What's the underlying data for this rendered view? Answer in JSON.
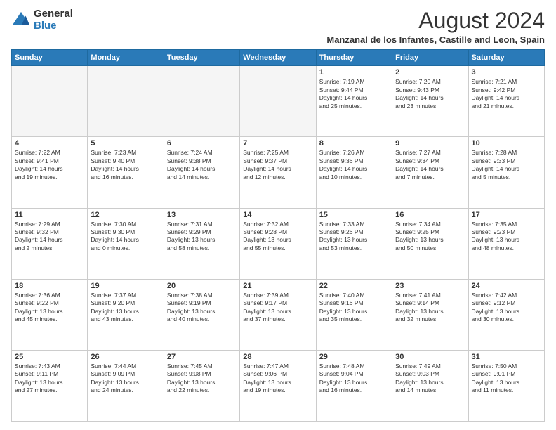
{
  "header": {
    "logo_general": "General",
    "logo_blue": "Blue",
    "title": "August 2024",
    "subtitle": "Manzanal de los Infantes, Castille and Leon, Spain"
  },
  "columns": [
    "Sunday",
    "Monday",
    "Tuesday",
    "Wednesday",
    "Thursday",
    "Friday",
    "Saturday"
  ],
  "weeks": [
    [
      {
        "day": "",
        "info": ""
      },
      {
        "day": "",
        "info": ""
      },
      {
        "day": "",
        "info": ""
      },
      {
        "day": "",
        "info": ""
      },
      {
        "day": "1",
        "info": "Sunrise: 7:19 AM\nSunset: 9:44 PM\nDaylight: 14 hours\nand 25 minutes."
      },
      {
        "day": "2",
        "info": "Sunrise: 7:20 AM\nSunset: 9:43 PM\nDaylight: 14 hours\nand 23 minutes."
      },
      {
        "day": "3",
        "info": "Sunrise: 7:21 AM\nSunset: 9:42 PM\nDaylight: 14 hours\nand 21 minutes."
      }
    ],
    [
      {
        "day": "4",
        "info": "Sunrise: 7:22 AM\nSunset: 9:41 PM\nDaylight: 14 hours\nand 19 minutes."
      },
      {
        "day": "5",
        "info": "Sunrise: 7:23 AM\nSunset: 9:40 PM\nDaylight: 14 hours\nand 16 minutes."
      },
      {
        "day": "6",
        "info": "Sunrise: 7:24 AM\nSunset: 9:38 PM\nDaylight: 14 hours\nand 14 minutes."
      },
      {
        "day": "7",
        "info": "Sunrise: 7:25 AM\nSunset: 9:37 PM\nDaylight: 14 hours\nand 12 minutes."
      },
      {
        "day": "8",
        "info": "Sunrise: 7:26 AM\nSunset: 9:36 PM\nDaylight: 14 hours\nand 10 minutes."
      },
      {
        "day": "9",
        "info": "Sunrise: 7:27 AM\nSunset: 9:34 PM\nDaylight: 14 hours\nand 7 minutes."
      },
      {
        "day": "10",
        "info": "Sunrise: 7:28 AM\nSunset: 9:33 PM\nDaylight: 14 hours\nand 5 minutes."
      }
    ],
    [
      {
        "day": "11",
        "info": "Sunrise: 7:29 AM\nSunset: 9:32 PM\nDaylight: 14 hours\nand 2 minutes."
      },
      {
        "day": "12",
        "info": "Sunrise: 7:30 AM\nSunset: 9:30 PM\nDaylight: 14 hours\nand 0 minutes."
      },
      {
        "day": "13",
        "info": "Sunrise: 7:31 AM\nSunset: 9:29 PM\nDaylight: 13 hours\nand 58 minutes."
      },
      {
        "day": "14",
        "info": "Sunrise: 7:32 AM\nSunset: 9:28 PM\nDaylight: 13 hours\nand 55 minutes."
      },
      {
        "day": "15",
        "info": "Sunrise: 7:33 AM\nSunset: 9:26 PM\nDaylight: 13 hours\nand 53 minutes."
      },
      {
        "day": "16",
        "info": "Sunrise: 7:34 AM\nSunset: 9:25 PM\nDaylight: 13 hours\nand 50 minutes."
      },
      {
        "day": "17",
        "info": "Sunrise: 7:35 AM\nSunset: 9:23 PM\nDaylight: 13 hours\nand 48 minutes."
      }
    ],
    [
      {
        "day": "18",
        "info": "Sunrise: 7:36 AM\nSunset: 9:22 PM\nDaylight: 13 hours\nand 45 minutes."
      },
      {
        "day": "19",
        "info": "Sunrise: 7:37 AM\nSunset: 9:20 PM\nDaylight: 13 hours\nand 43 minutes."
      },
      {
        "day": "20",
        "info": "Sunrise: 7:38 AM\nSunset: 9:19 PM\nDaylight: 13 hours\nand 40 minutes."
      },
      {
        "day": "21",
        "info": "Sunrise: 7:39 AM\nSunset: 9:17 PM\nDaylight: 13 hours\nand 37 minutes."
      },
      {
        "day": "22",
        "info": "Sunrise: 7:40 AM\nSunset: 9:16 PM\nDaylight: 13 hours\nand 35 minutes."
      },
      {
        "day": "23",
        "info": "Sunrise: 7:41 AM\nSunset: 9:14 PM\nDaylight: 13 hours\nand 32 minutes."
      },
      {
        "day": "24",
        "info": "Sunrise: 7:42 AM\nSunset: 9:12 PM\nDaylight: 13 hours\nand 30 minutes."
      }
    ],
    [
      {
        "day": "25",
        "info": "Sunrise: 7:43 AM\nSunset: 9:11 PM\nDaylight: 13 hours\nand 27 minutes."
      },
      {
        "day": "26",
        "info": "Sunrise: 7:44 AM\nSunset: 9:09 PM\nDaylight: 13 hours\nand 24 minutes."
      },
      {
        "day": "27",
        "info": "Sunrise: 7:45 AM\nSunset: 9:08 PM\nDaylight: 13 hours\nand 22 minutes."
      },
      {
        "day": "28",
        "info": "Sunrise: 7:47 AM\nSunset: 9:06 PM\nDaylight: 13 hours\nand 19 minutes."
      },
      {
        "day": "29",
        "info": "Sunrise: 7:48 AM\nSunset: 9:04 PM\nDaylight: 13 hours\nand 16 minutes."
      },
      {
        "day": "30",
        "info": "Sunrise: 7:49 AM\nSunset: 9:03 PM\nDaylight: 13 hours\nand 14 minutes."
      },
      {
        "day": "31",
        "info": "Sunrise: 7:50 AM\nSunset: 9:01 PM\nDaylight: 13 hours\nand 11 minutes."
      }
    ]
  ]
}
